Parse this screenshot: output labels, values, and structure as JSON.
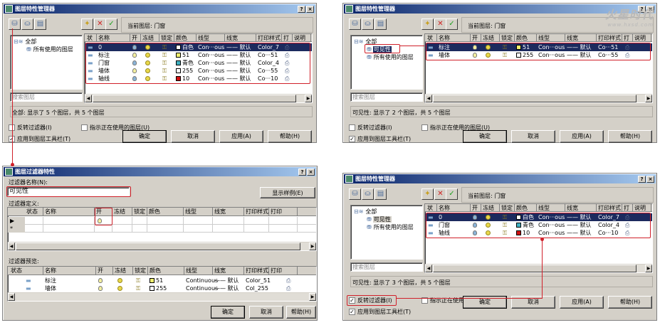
{
  "managers": [
    {
      "id": "m1",
      "title": "图层特性管理器",
      "current_layer": "当前图层: 门窗",
      "search_placeholder": "搜索图层",
      "tree": [
        {
          "label": "全部",
          "level": 0,
          "selected": false
        },
        {
          "label": "所有使用的图层",
          "level": 1,
          "selected": false
        }
      ],
      "columns": [
        "状",
        "名称",
        "开",
        "冻结",
        "锁定",
        "颜色",
        "线型",
        "线宽",
        "打印样式",
        "打",
        "说明"
      ],
      "rows": [
        {
          "status": "layer",
          "name": "0",
          "on": false,
          "color": "白色",
          "color_hex": "#ffffff",
          "linetype": "Con···ous",
          "lineweight": "—— 默认",
          "plotstyle": "Color_7",
          "selected": true
        },
        {
          "status": "layer",
          "name": "标注",
          "on": true,
          "color": "51",
          "color_hex": "#f0f070",
          "linetype": "Con···ous",
          "lineweight": "—— 默认",
          "plotstyle": "Co···51",
          "selected": false
        },
        {
          "status": "current",
          "name": "门窗",
          "on": false,
          "color": "青色",
          "color_hex": "#40b0c0",
          "linetype": "Con···ous",
          "lineweight": "—— 默认",
          "plotstyle": "Color_4",
          "selected": false
        },
        {
          "status": "layer",
          "name": "墙体",
          "on": true,
          "color": "255",
          "color_hex": "#ffffff",
          "linetype": "Con···ous",
          "lineweight": "—— 默认",
          "plotstyle": "Co···55",
          "selected": false
        },
        {
          "status": "layer",
          "name": "轴线",
          "on": false,
          "color": "10",
          "color_hex": "#d01010",
          "linetype": "Con···ous",
          "lineweight": "—— 默认",
          "plotstyle": "Co···10",
          "selected": false
        }
      ],
      "status_text": "全部: 显示了 5 个图层，共 5 个图层",
      "checks": [
        {
          "label": "反转过滤器(I)",
          "checked": false
        },
        {
          "label": "指示正在使用的图层(U)",
          "checked": false
        },
        {
          "label": "应用到图层工具栏(T)",
          "checked": true
        }
      ],
      "buttons": [
        "确定",
        "取消",
        "应用(A)",
        "帮助(H)"
      ]
    },
    {
      "id": "m2",
      "title": "图层特性管理器",
      "current_layer": "当前图层: 门窗",
      "search_placeholder": "搜索图层",
      "tree": [
        {
          "label": "全部",
          "level": 0,
          "selected": false
        },
        {
          "label": "可见性",
          "level": 1,
          "selected": true
        },
        {
          "label": "所有使用的图层",
          "level": 1,
          "selected": false
        }
      ],
      "columns": [
        "状",
        "名称",
        "开",
        "冻结",
        "锁定",
        "颜色",
        "线型",
        "线宽",
        "打印样式",
        "打",
        "说明"
      ],
      "rows": [
        {
          "status": "layer",
          "name": "标注",
          "on": true,
          "color": "51",
          "color_hex": "#f0f070",
          "linetype": "Con···ous",
          "lineweight": "—— 默认",
          "plotstyle": "Co···51",
          "selected": true
        },
        {
          "status": "layer",
          "name": "墙体",
          "on": true,
          "color": "255",
          "color_hex": "#ffffff",
          "linetype": "Con···ous",
          "lineweight": "—— 默认",
          "plotstyle": "Co···55",
          "selected": false
        }
      ],
      "status_text": "可见性: 显示了 2 个图层，共 5 个图层",
      "checks": [
        {
          "label": "反转过滤器(I)",
          "checked": false
        },
        {
          "label": "指示正在使用的图层(U)",
          "checked": false
        },
        {
          "label": "应用到图层工具栏(T)",
          "checked": true
        }
      ],
      "buttons": [
        "确定",
        "取消",
        "应用(A)",
        "帮助(H)"
      ],
      "logo": {
        "name": "火星时代",
        "url": "www.hxsd.com"
      }
    },
    {
      "id": "m4",
      "title": "图层特性管理器",
      "current_layer": "当前图层: 门窗",
      "search_placeholder": "搜索图层",
      "tree": [
        {
          "label": "全部",
          "level": 0,
          "selected": false
        },
        {
          "label": "可见性",
          "level": 1,
          "selected": false,
          "grey": true
        },
        {
          "label": "所有使用的图层",
          "level": 1,
          "selected": false
        }
      ],
      "columns": [
        "状",
        "名称",
        "开",
        "冻结",
        "锁定",
        "颜色",
        "线型",
        "线宽",
        "打印样式",
        "打",
        "说明"
      ],
      "rows": [
        {
          "status": "layer",
          "name": "0",
          "on": false,
          "color": "白色",
          "color_hex": "#ffffff",
          "linetype": "Con···ous",
          "lineweight": "—— 默认",
          "plotstyle": "Color_7",
          "selected": true
        },
        {
          "status": "current",
          "name": "门窗",
          "on": false,
          "color": "青色",
          "color_hex": "#40b0c0",
          "linetype": "Con···ous",
          "lineweight": "—— 默认",
          "plotstyle": "Color_4",
          "selected": false
        },
        {
          "status": "layer",
          "name": "轴线",
          "on": false,
          "color": "10",
          "color_hex": "#d01010",
          "linetype": "Con···ous",
          "lineweight": "—— 默认",
          "plotstyle": "Co···10",
          "selected": false
        }
      ],
      "status_text": "可见性: 显示了 3 个图层，共 5 个图层",
      "checks": [
        {
          "label": "反转过滤器(I)",
          "checked": true
        },
        {
          "label": "指示正在使用的图层(U)",
          "checked": false
        },
        {
          "label": "应用到图层工具栏(T)",
          "checked": true
        }
      ],
      "buttons": [
        "确定",
        "取消",
        "应用(A)",
        "帮助(H)"
      ]
    }
  ],
  "filter_dialog": {
    "title": "图层过滤器特性",
    "name_label": "过滤器名称(N):",
    "name_value": "可见性",
    "show_example_button": "显示样例(E)",
    "definition_label": "过滤器定义:",
    "definition_columns": [
      "状态",
      "名称",
      "开",
      "冻结",
      "锁定",
      "颜色",
      "线型",
      "线宽",
      "打印样式",
      "打印"
    ],
    "definition_rows": [
      {
        "marker": "▶",
        "on": true
      },
      {
        "marker": "*",
        "on": null
      }
    ],
    "preview_label": "过滤器预览:",
    "preview_columns": [
      "状态",
      "名称",
      "开",
      "冻结",
      "锁定",
      "颜色",
      "线型",
      "线宽",
      "打印样式",
      "打印"
    ],
    "preview_rows": [
      {
        "name": "标注",
        "color": "51",
        "color_hex": "#f0f070",
        "linetype": "Continuous",
        "lineweight": "—— 默认",
        "plotstyle": "Color_51"
      },
      {
        "name": "墙体",
        "color": "255",
        "color_hex": "#ffffff",
        "linetype": "Continuous",
        "lineweight": "—— 默认",
        "plotstyle": "Col_255"
      }
    ],
    "buttons": [
      "确定",
      "取消",
      "帮助(H)"
    ]
  },
  "colors": {
    "accent": "#d0202a",
    "title_bar": "#0a246a",
    "dialog_bg": "#d4d0c8",
    "selected_row": "#1c2a5e"
  }
}
